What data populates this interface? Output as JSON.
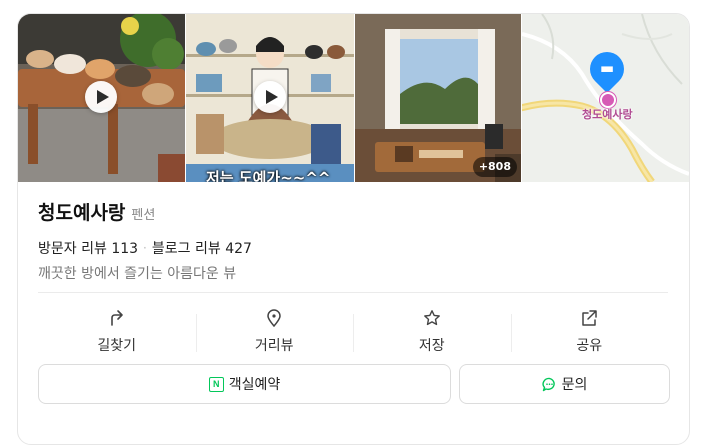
{
  "place": {
    "name": "청도예사랑",
    "category": "펜션",
    "reviews": {
      "visitor_label": "방문자 리뷰",
      "visitor_count": "113",
      "blog_label": "블로그 리뷰",
      "blog_count": "427"
    },
    "description": "깨끗한 방에서 즐기는 아름다운 뷰"
  },
  "photos": {
    "more_count": "+808",
    "caption_overlay": "저는 도예가~~^^",
    "map_label": "청도예사랑"
  },
  "actions": [
    {
      "label": "길찾기",
      "icon": "directions-icon"
    },
    {
      "label": "거리뷰",
      "icon": "street-view-icon"
    },
    {
      "label": "저장",
      "icon": "star-icon"
    },
    {
      "label": "공유",
      "icon": "share-icon"
    }
  ],
  "buttons": {
    "book_label": "객실예약",
    "inquiry_label": "문의"
  },
  "colors": {
    "naver_green": "#03c75a",
    "map_pin": "#1e90ff",
    "place_marker": "#d65bb5"
  }
}
